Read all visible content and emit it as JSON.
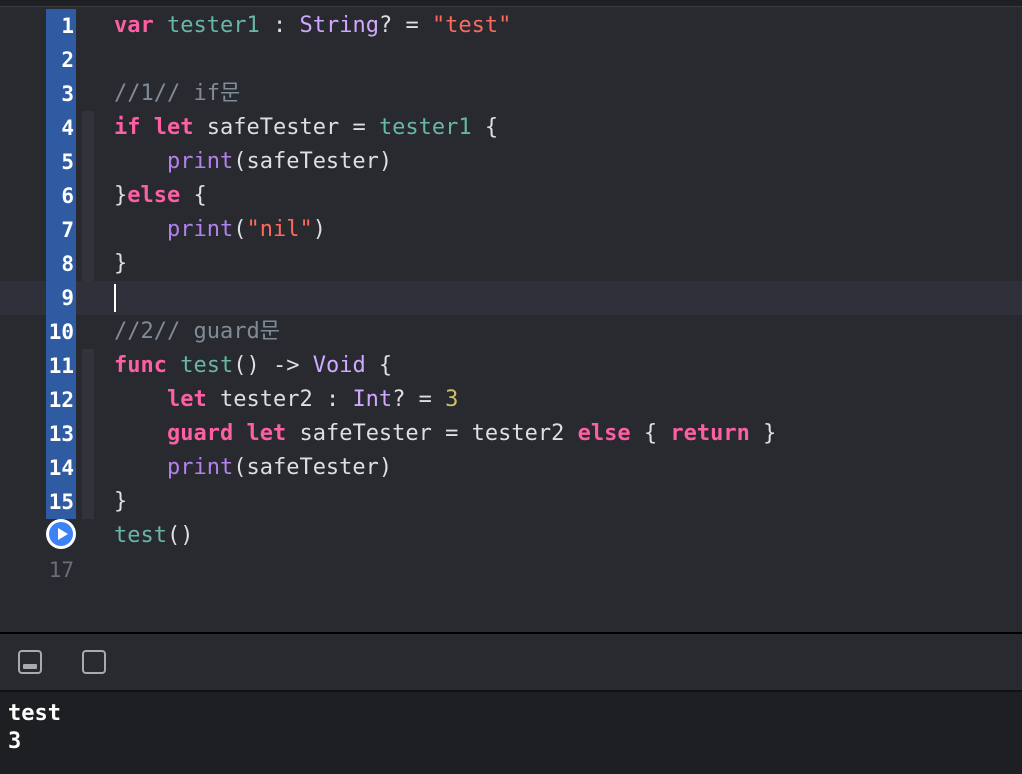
{
  "editor": {
    "lines": [
      {
        "n": "1",
        "tokens": [
          {
            "t": "var",
            "c": "kw"
          },
          {
            "t": " ",
            "c": "plain"
          },
          {
            "t": "tester1",
            "c": "fn"
          },
          {
            "t": " : ",
            "c": "plain"
          },
          {
            "t": "String",
            "c": "ty"
          },
          {
            "t": "? = ",
            "c": "plain"
          },
          {
            "t": "\"test\"",
            "c": "str"
          }
        ]
      },
      {
        "n": "2",
        "tokens": []
      },
      {
        "n": "3",
        "tokens": [
          {
            "t": "//1// if문",
            "c": "cm"
          }
        ]
      },
      {
        "n": "4",
        "tokens": [
          {
            "t": "if",
            "c": "kw"
          },
          {
            "t": " ",
            "c": "plain"
          },
          {
            "t": "let",
            "c": "kw"
          },
          {
            "t": " safeTester = ",
            "c": "plain"
          },
          {
            "t": "tester1",
            "c": "fn"
          },
          {
            "t": " {",
            "c": "plain"
          }
        ]
      },
      {
        "n": "5",
        "tokens": [
          {
            "t": "    ",
            "c": "plain"
          },
          {
            "t": "print",
            "c": "call"
          },
          {
            "t": "(safeTester)",
            "c": "plain"
          }
        ]
      },
      {
        "n": "6",
        "tokens": [
          {
            "t": "}",
            "c": "plain"
          },
          {
            "t": "else",
            "c": "kw"
          },
          {
            "t": " {",
            "c": "plain"
          }
        ]
      },
      {
        "n": "7",
        "tokens": [
          {
            "t": "    ",
            "c": "plain"
          },
          {
            "t": "print",
            "c": "call"
          },
          {
            "t": "(",
            "c": "plain"
          },
          {
            "t": "\"nil\"",
            "c": "str"
          },
          {
            "t": ")",
            "c": "plain"
          }
        ]
      },
      {
        "n": "8",
        "tokens": [
          {
            "t": "}",
            "c": "plain"
          }
        ]
      },
      {
        "n": "9",
        "tokens": []
      },
      {
        "n": "10",
        "tokens": [
          {
            "t": "//2// guard문",
            "c": "cm"
          }
        ]
      },
      {
        "n": "11",
        "tokens": [
          {
            "t": "func",
            "c": "kw"
          },
          {
            "t": " ",
            "c": "plain"
          },
          {
            "t": "test",
            "c": "fn"
          },
          {
            "t": "() -> ",
            "c": "plain"
          },
          {
            "t": "Void",
            "c": "ty"
          },
          {
            "t": " {",
            "c": "plain"
          }
        ]
      },
      {
        "n": "12",
        "tokens": [
          {
            "t": "    ",
            "c": "plain"
          },
          {
            "t": "let",
            "c": "kw"
          },
          {
            "t": " tester2 : ",
            "c": "plain"
          },
          {
            "t": "Int",
            "c": "ty"
          },
          {
            "t": "? = ",
            "c": "plain"
          },
          {
            "t": "3",
            "c": "num"
          }
        ]
      },
      {
        "n": "13",
        "tokens": [
          {
            "t": "    ",
            "c": "plain"
          },
          {
            "t": "guard",
            "c": "kw"
          },
          {
            "t": " ",
            "c": "plain"
          },
          {
            "t": "let",
            "c": "kw"
          },
          {
            "t": " safeTester = tester2 ",
            "c": "plain"
          },
          {
            "t": "else",
            "c": "kw"
          },
          {
            "t": " { ",
            "c": "plain"
          },
          {
            "t": "return",
            "c": "kw"
          },
          {
            "t": " }",
            "c": "plain"
          }
        ]
      },
      {
        "n": "14",
        "tokens": [
          {
            "t": "    ",
            "c": "plain"
          },
          {
            "t": "print",
            "c": "call"
          },
          {
            "t": "(safeTester)",
            "c": "plain"
          }
        ]
      },
      {
        "n": "15",
        "tokens": [
          {
            "t": "}",
            "c": "plain"
          }
        ]
      },
      {
        "n": "",
        "tokens": [
          {
            "t": "test",
            "c": "fn"
          },
          {
            "t": "()",
            "c": "plain"
          }
        ]
      },
      {
        "n": "17",
        "tokens": []
      }
    ],
    "current_line": "9"
  },
  "console": {
    "output": [
      "test",
      "3"
    ]
  },
  "colors": {
    "keyword": "#fc5fa3",
    "type": "#d0a8ff",
    "identifier": "#67b7a4",
    "call": "#b281eb",
    "string": "#fc6a5d",
    "number": "#d0bf69",
    "comment": "#7f8c98",
    "gutter_run": "#2f5ba2",
    "background": "#292a30"
  },
  "icons": {
    "run_button": "play-circle-icon",
    "hide_debug": "hide-debug-area-icon",
    "console": "console-icon"
  }
}
